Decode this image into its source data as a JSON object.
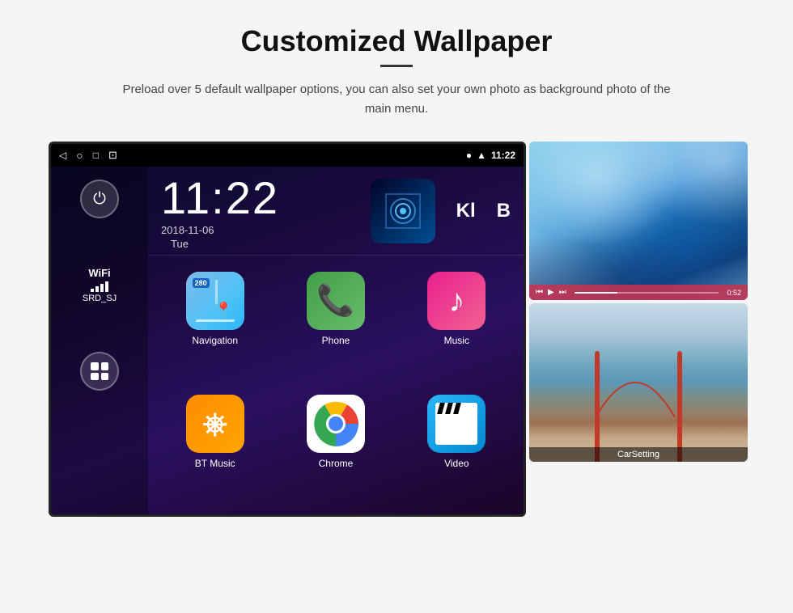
{
  "page": {
    "title": "Customized Wallpaper",
    "divider": "—",
    "description": "Preload over 5 default wallpaper options, you can also set your own photo as background photo of the main menu."
  },
  "device": {
    "status_bar": {
      "time": "11:22",
      "icons_left": [
        "back-arrow",
        "home-circle",
        "recents-square",
        "image-icon"
      ],
      "icons_right": [
        "location-pin",
        "wifi-filled"
      ]
    },
    "clock": {
      "time": "11:22",
      "date": "2018-11-06",
      "day": "Tue"
    },
    "sidebar": {
      "power_label": "power",
      "wifi_label": "WiFi",
      "wifi_ssid": "SRD_SJ",
      "apps_label": "apps"
    },
    "apps": [
      {
        "id": "navigation",
        "label": "Navigation",
        "icon": "map-icon"
      },
      {
        "id": "phone",
        "label": "Phone",
        "icon": "phone-icon"
      },
      {
        "id": "music",
        "label": "Music",
        "icon": "music-icon"
      },
      {
        "id": "bt-music",
        "label": "BT Music",
        "icon": "bluetooth-icon"
      },
      {
        "id": "chrome",
        "label": "Chrome",
        "icon": "chrome-icon"
      },
      {
        "id": "video",
        "label": "Video",
        "icon": "video-icon"
      }
    ]
  },
  "wallpapers": [
    {
      "id": "ice-cave",
      "label": ""
    },
    {
      "id": "golden-gate",
      "label": "CarSetting"
    }
  ]
}
